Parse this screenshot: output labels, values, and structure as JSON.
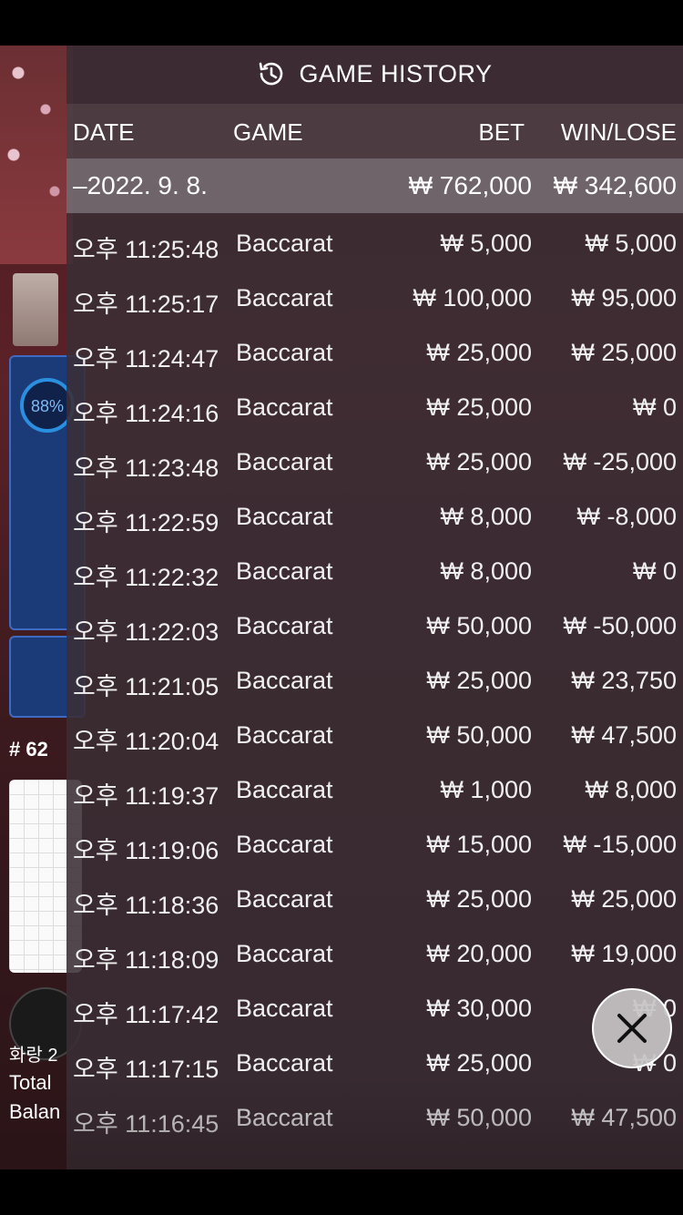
{
  "background": {
    "percent": "88%",
    "round": "# 62",
    "label_1": "화랑 2",
    "label_2": "Total",
    "label_3": "Balan"
  },
  "history": {
    "title": "GAME HISTORY",
    "icon": "history-clock-icon",
    "columns": {
      "date": "DATE",
      "game": "GAME",
      "bet": "BET",
      "win_lose": "WIN/LOSE"
    },
    "summary": {
      "date": "–2022. 9. 8.",
      "bet": "₩ 762,000",
      "win_lose": "₩ 342,600"
    },
    "rows": [
      {
        "time": "오후 11:25:48",
        "game": "Baccarat",
        "bet": "₩ 5,000",
        "win_lose": "₩ 5,000"
      },
      {
        "time": "오후 11:25:17",
        "game": "Baccarat",
        "bet": "₩ 100,000",
        "win_lose": "₩ 95,000"
      },
      {
        "time": "오후 11:24:47",
        "game": "Baccarat",
        "bet": "₩ 25,000",
        "win_lose": "₩ 25,000"
      },
      {
        "time": "오후 11:24:16",
        "game": "Baccarat",
        "bet": "₩ 25,000",
        "win_lose": "₩ 0"
      },
      {
        "time": "오후 11:23:48",
        "game": "Baccarat",
        "bet": "₩ 25,000",
        "win_lose": "₩ -25,000"
      },
      {
        "time": "오후 11:22:59",
        "game": "Baccarat",
        "bet": "₩ 8,000",
        "win_lose": "₩ -8,000"
      },
      {
        "time": "오후 11:22:32",
        "game": "Baccarat",
        "bet": "₩ 8,000",
        "win_lose": "₩ 0"
      },
      {
        "time": "오후 11:22:03",
        "game": "Baccarat",
        "bet": "₩ 50,000",
        "win_lose": "₩ -50,000"
      },
      {
        "time": "오후 11:21:05",
        "game": "Baccarat",
        "bet": "₩ 25,000",
        "win_lose": "₩ 23,750"
      },
      {
        "time": "오후 11:20:04",
        "game": "Baccarat",
        "bet": "₩ 50,000",
        "win_lose": "₩ 47,500"
      },
      {
        "time": "오후 11:19:37",
        "game": "Baccarat",
        "bet": "₩ 1,000",
        "win_lose": "₩ 8,000"
      },
      {
        "time": "오후 11:19:06",
        "game": "Baccarat",
        "bet": "₩ 15,000",
        "win_lose": "₩ -15,000"
      },
      {
        "time": "오후 11:18:36",
        "game": "Baccarat",
        "bet": "₩ 25,000",
        "win_lose": "₩ 25,000"
      },
      {
        "time": "오후 11:18:09",
        "game": "Baccarat",
        "bet": "₩ 20,000",
        "win_lose": "₩ 19,000"
      },
      {
        "time": "오후 11:17:42",
        "game": "Baccarat",
        "bet": "₩ 30,000",
        "win_lose": "₩ 0"
      },
      {
        "time": "오후 11:17:15",
        "game": "Baccarat",
        "bet": "₩ 25,000",
        "win_lose": "₩ 0"
      },
      {
        "time": "오후 11:16:45",
        "game": "Baccarat",
        "bet": "₩ 50,000",
        "win_lose": "₩ 47,500"
      }
    ]
  },
  "close_icon": "close-x-icon"
}
